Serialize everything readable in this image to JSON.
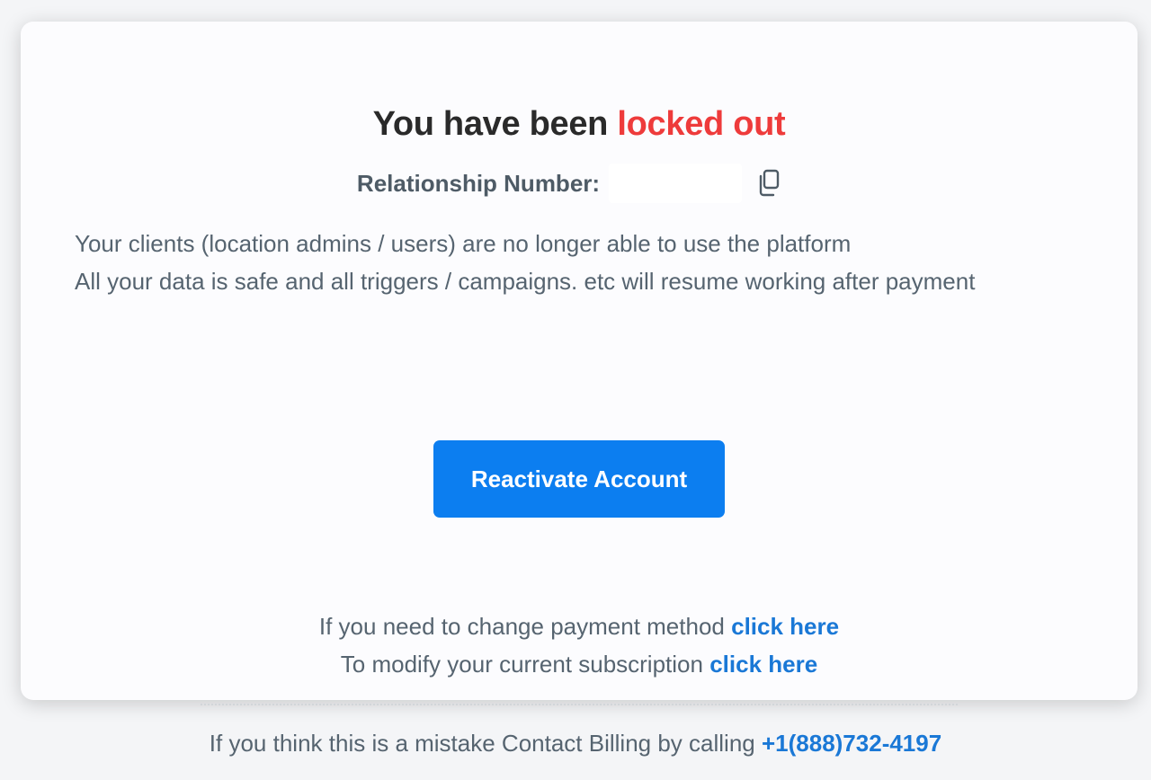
{
  "title": {
    "prefix": "You have been",
    "accent": "locked out",
    "accent_color": "#ee3b3b"
  },
  "relationship": {
    "label": "Relationship Number:",
    "value": "",
    "copy_icon": "copy-icon"
  },
  "message": {
    "line1": "Your clients (location admins / users) are no longer able to use the platform",
    "line2": "All your data is safe and all triggers / campaigns. etc will resume working after payment"
  },
  "reactivate_button": {
    "label": "Reactivate Account",
    "color": "#0c7ef0"
  },
  "payment_link": {
    "text": "If you need to change payment method",
    "link": "click here"
  },
  "subscription_link": {
    "text": "To modify your current subscription",
    "link": "click here"
  },
  "footer": {
    "text": "If you think this is a mistake Contact Billing by calling",
    "phone": "+1(888)732-4197"
  }
}
